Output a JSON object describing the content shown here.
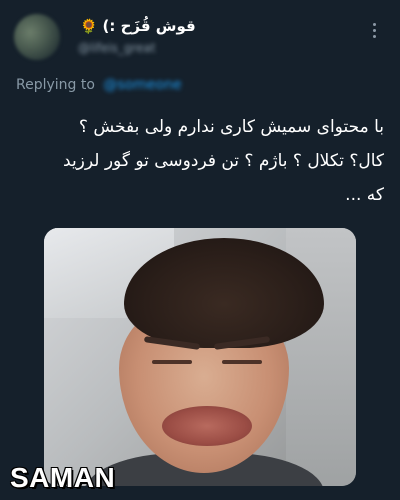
{
  "tweet": {
    "author": {
      "display_name": "قوش قُزَح :)",
      "handle": "@lifeis_great",
      "avatar_icon": "avatar"
    },
    "more_icon": "more-vertical-icon",
    "replying_to": {
      "label": "Replying to",
      "handle": "@someone"
    },
    "text_lines": [
      "با محتوای سمیش کاری ندارم ولی بفخش ؟",
      "کال؟ تکلال ؟ باژم ؟ تن فردوسی تو گور لرزید",
      "که ..."
    ]
  },
  "watermark": "SAMAN",
  "colors": {
    "background": "#15202b",
    "text_primary": "#ffffff",
    "text_secondary": "#8899a6",
    "link": "#1d9bf0"
  }
}
